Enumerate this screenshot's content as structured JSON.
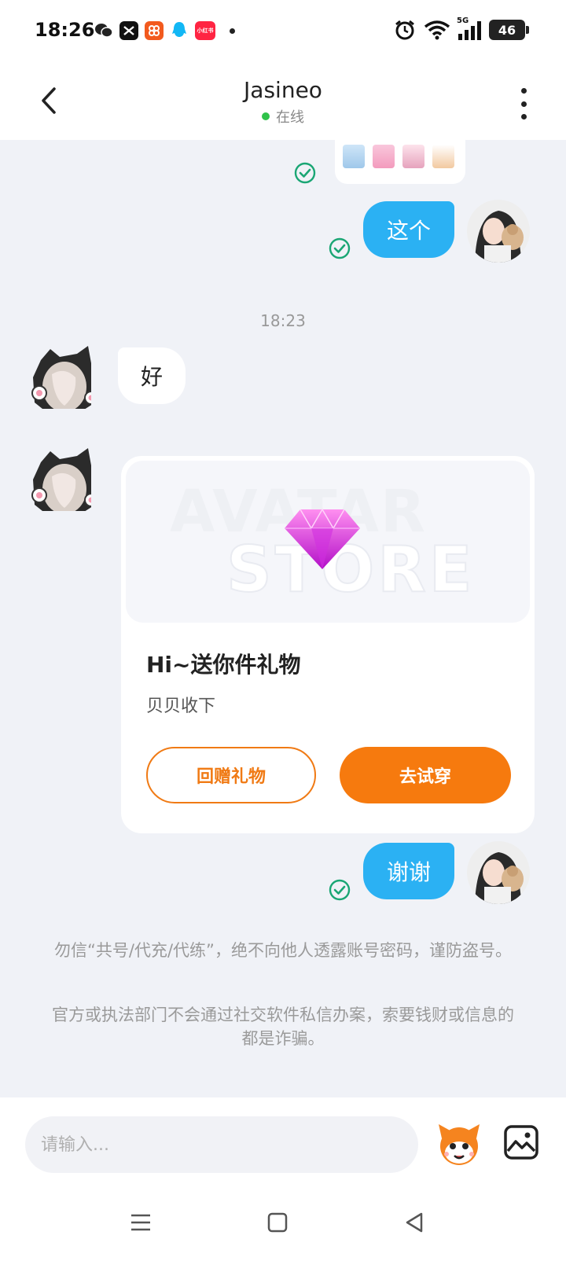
{
  "status_bar": {
    "time": "18:26",
    "app_icons": [
      "wechat-icon",
      "capcut-icon",
      "shopping-icon",
      "qq-icon",
      "xiaohongshu-icon"
    ],
    "xhs_label": "小红书",
    "network": "5G",
    "battery": "46"
  },
  "header": {
    "contact_name": "Jasineo",
    "status": "在线",
    "status_color": "#2fc24a"
  },
  "messages": {
    "msg_zhege": "这个",
    "timestamp": "18:23",
    "msg_hao": "好",
    "gift_card": {
      "banner_watermark_1": "AVATAR",
      "banner_watermark_2": "STORE",
      "title": "Hi~送你件礼物",
      "subtitle": "贝贝收下",
      "return_gift_label": "回赠礼物",
      "try_on_label": "去试穿"
    },
    "msg_xiexie": "谢谢"
  },
  "notices": {
    "line1": "勿信“共号/代充/代练”，绝不向他人透露账号密码，谨防盗号。",
    "line2": "官方或执法部门不会通过社交软件私信办案，索要钱财或信息的都是诈骗。"
  },
  "input": {
    "placeholder": "请输入..."
  },
  "colors": {
    "my_bubble": "#2bb1f3",
    "accent_orange": "#f67a0e",
    "read_check": "#1aa674"
  }
}
